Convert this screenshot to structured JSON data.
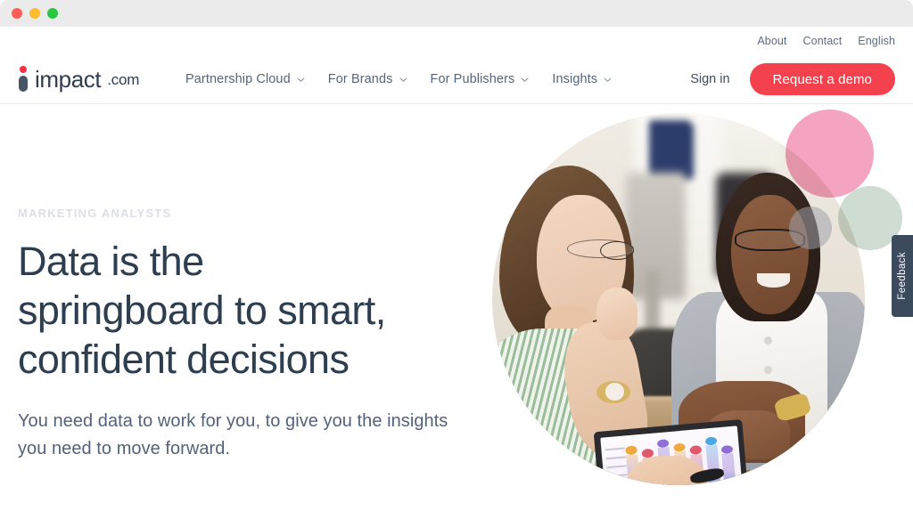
{
  "window": {
    "traffic_lights": [
      {
        "name": "close",
        "color": "#ff5f57"
      },
      {
        "name": "minimize",
        "color": "#febc2e"
      },
      {
        "name": "maximize",
        "color": "#28c840"
      }
    ]
  },
  "header": {
    "logo": {
      "word": "impact",
      "tld": ".com"
    },
    "utility_links": [
      "About",
      "Contact",
      "English"
    ],
    "nav": [
      {
        "label": "Partnership Cloud",
        "has_dropdown": true,
        "icon": "chevron-down-icon"
      },
      {
        "label": "For Brands",
        "has_dropdown": true,
        "icon": "chevron-down-icon"
      },
      {
        "label": "For Publishers",
        "has_dropdown": true,
        "icon": "chevron-down-icon"
      },
      {
        "label": "Insights",
        "has_dropdown": true,
        "icon": "chevron-down-icon"
      }
    ],
    "signin_label": "Sign in",
    "cta_label": "Request a demo",
    "cta_color": "#f4414e"
  },
  "hero": {
    "eyebrow": "MARKETING ANALYSTS",
    "title_line1": "Data is the",
    "title_line2": "springboard to smart,",
    "title_line3": "confident decisions",
    "subtext": "You need data to work for you, to give you the insights you need to move forward.",
    "title_color": "#2d3e50",
    "eyebrow_color": "#dbdfe6",
    "image_alt": "Two women collaborating at a desk reviewing a tablet with a data chart",
    "decor": {
      "pink_circle": "#f4a3c0",
      "sage_circle": "#cfdcd2",
      "gray_circle": "#a0a0aa"
    }
  },
  "tablet_chart": {
    "colors": [
      "#f0a93c",
      "#e05a6c",
      "#8f6fd6",
      "#f0a93c",
      "#e05a6c",
      "#4aa9e0",
      "#8f6fd6"
    ],
    "heights": [
      72,
      64,
      80,
      70,
      62,
      76,
      58
    ]
  },
  "feedback": {
    "label": "Feedback",
    "color": "#3c4a5d"
  }
}
